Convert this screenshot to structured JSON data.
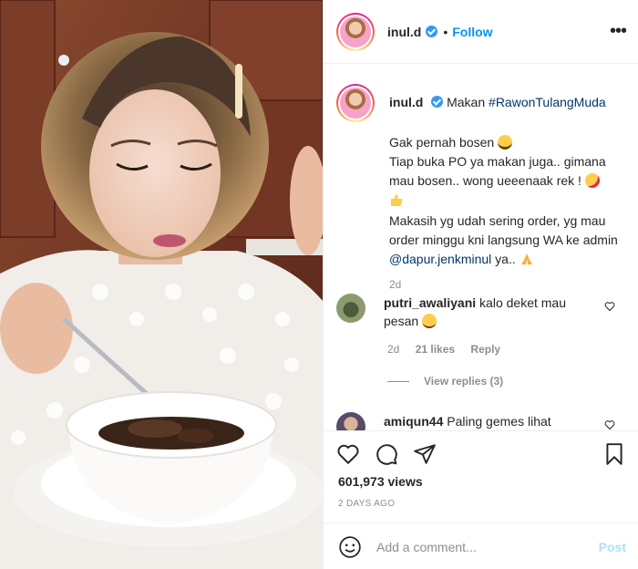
{
  "post": {
    "username": "inul.d",
    "follow_label": "Follow",
    "separator": "•",
    "more_label": "•••",
    "caption_prefix": "Makan ",
    "caption_hashtag": "#RawonTulangMuda",
    "caption_line1": "Gak pernah bosen",
    "caption_line2": "Tiap buka PO ya makan juga.. gimana mau bosen.. wong ueeenaak rek !",
    "caption_line3": "Makasih yg udah sering order, yg mau order minggu kni langsung WA ke admin ",
    "caption_mention": "@dapur.jenkminul",
    "caption_line3_end": " ya..",
    "time_ago": "2d"
  },
  "comments": [
    {
      "username": "putri_awaliyani",
      "text": "kalo deket mau pesan",
      "time": "2d",
      "likes": "21 likes",
      "reply_label": "Reply",
      "view_replies": "View replies (3)"
    },
    {
      "username": "amiqun44",
      "text": "Paling gemes lihat"
    }
  ],
  "actions": {
    "views": "601,973 views",
    "date": "2 DAYS AGO",
    "comment_placeholder": "Add a comment...",
    "post_label": "Post"
  },
  "icons": {
    "verified": "verified-badge-icon",
    "like": "heart-icon",
    "comment": "comment-icon",
    "share": "share-icon",
    "save": "bookmark-icon",
    "emoji": "smiley-icon"
  },
  "colors": {
    "link_blue": "#0095f6",
    "hashtag": "#00376b",
    "muted": "#8e8e8e",
    "post_disabled": "#b2dffc"
  }
}
